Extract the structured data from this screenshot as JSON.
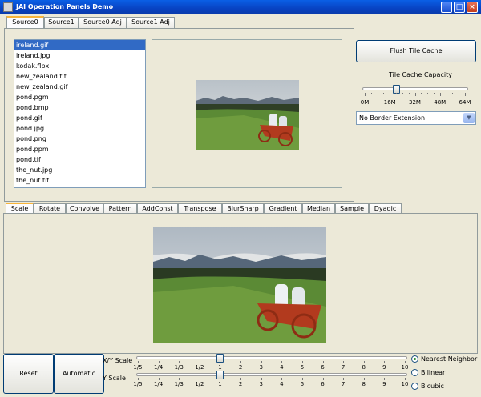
{
  "window": {
    "title": "JAI Operation Panels Demo"
  },
  "source_tabs": [
    "Source0",
    "Source1",
    "Source0 Adj",
    "Source1 Adj"
  ],
  "files": [
    "ireland.gif",
    "ireland.jpg",
    "kodak.flpx",
    "new_zealand.tif",
    "new_zealand.gif",
    "pond.pgm",
    "pond.bmp",
    "pond.gif",
    "pond.jpg",
    "pond.png",
    "pond.ppm",
    "pond.tif",
    "the_nut.jpg",
    "the_nut.tif"
  ],
  "selected_file": 0,
  "cache": {
    "flush_label": "Flush Tile Cache",
    "capacity_label": "Tile Cache Capacity",
    "capacity_value_mb": 20,
    "ticks": [
      "0M",
      "16M",
      "32M",
      "48M",
      "64M"
    ]
  },
  "border": {
    "selected": "No Border Extension"
  },
  "op_tabs": [
    "Scale",
    "Rotate",
    "Convolve",
    "Pattern",
    "AddConst",
    "Transpose",
    "BlurSharp",
    "Gradient",
    "Median",
    "Sample",
    "Dyadic"
  ],
  "scale": {
    "reset_label": "Reset",
    "auto_label": "Automatic",
    "xy_label": "X/Y Scale",
    "y_label": "Y Scale",
    "ticks": [
      "1/5",
      "1/4",
      "1/3",
      "1/2",
      "1",
      "2",
      "3",
      "4",
      "5",
      "6",
      "7",
      "8",
      "9",
      "10"
    ],
    "xy_value": "1",
    "y_value": "1",
    "interp": [
      "Nearest Neighbor",
      "Bilinear",
      "Bicubic"
    ],
    "interp_selected": 0
  },
  "colors": {
    "title_bar": "#0842c2",
    "tab_highlight": "#f8b43a",
    "selection": "#316ac5"
  }
}
